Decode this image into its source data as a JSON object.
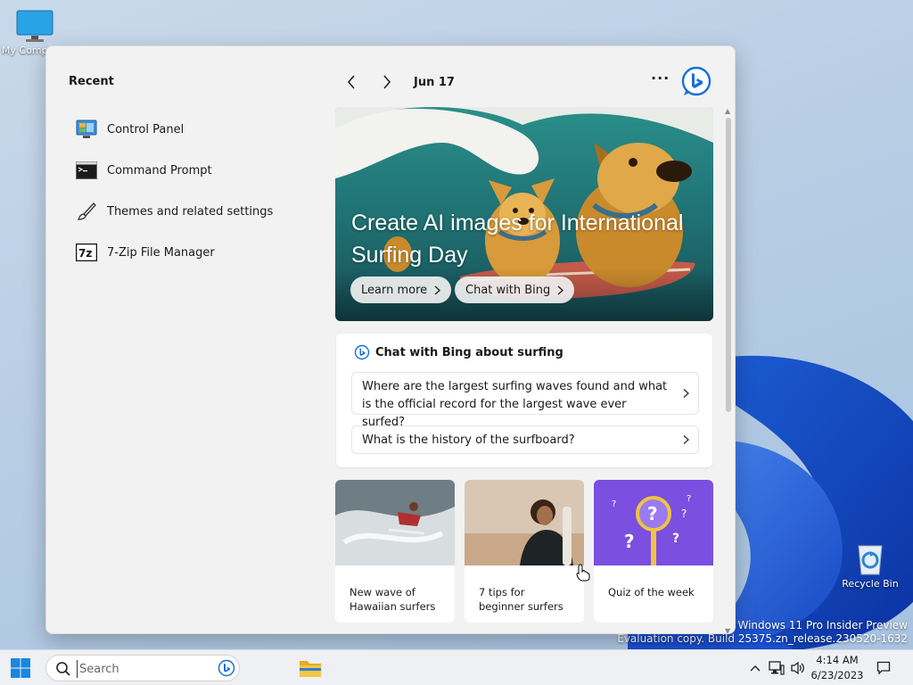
{
  "desktop": {
    "my_computer_label": "My Computer",
    "recycle_bin_label": "Recycle Bin",
    "watermark_line1": "Windows 11 Pro Insider Preview",
    "watermark_line2": "Evaluation copy. Build 25375.zn_release.230520-1632"
  },
  "panel": {
    "recent_title": "Recent",
    "recent_items": [
      {
        "label": "Control Panel",
        "icon": "control-panel-icon"
      },
      {
        "label": "Command Prompt",
        "icon": "command-prompt-icon"
      },
      {
        "label": "Themes and related settings",
        "icon": "brush-icon"
      },
      {
        "label": "7-Zip File Manager",
        "icon": "7zip-icon"
      }
    ],
    "nav": {
      "date": "Jun 17",
      "more": "···"
    },
    "hero": {
      "title": "Create AI images for International Surfing Day",
      "learn_more": "Learn more",
      "chat_with_bing": "Chat with Bing"
    },
    "chat_card": {
      "title": "Chat with Bing about surfing",
      "questions": [
        "Where are the largest surfing waves found and what is the official record for the largest wave ever surfed?",
        "What is the history of the surfboard?"
      ]
    },
    "tiles": [
      {
        "caption": "New wave of Hawaiian surfers"
      },
      {
        "caption": "7 tips for beginner surfers"
      },
      {
        "caption": "Quiz of the week"
      }
    ]
  },
  "taskbar": {
    "search_placeholder": "Search",
    "time": "4:14 AM",
    "date": "6/23/2023"
  },
  "colors": {
    "bing_blue": "#1a6fd8",
    "accent_blue": "#0a5fc4",
    "quiz_purple": "#7b4fdf"
  }
}
